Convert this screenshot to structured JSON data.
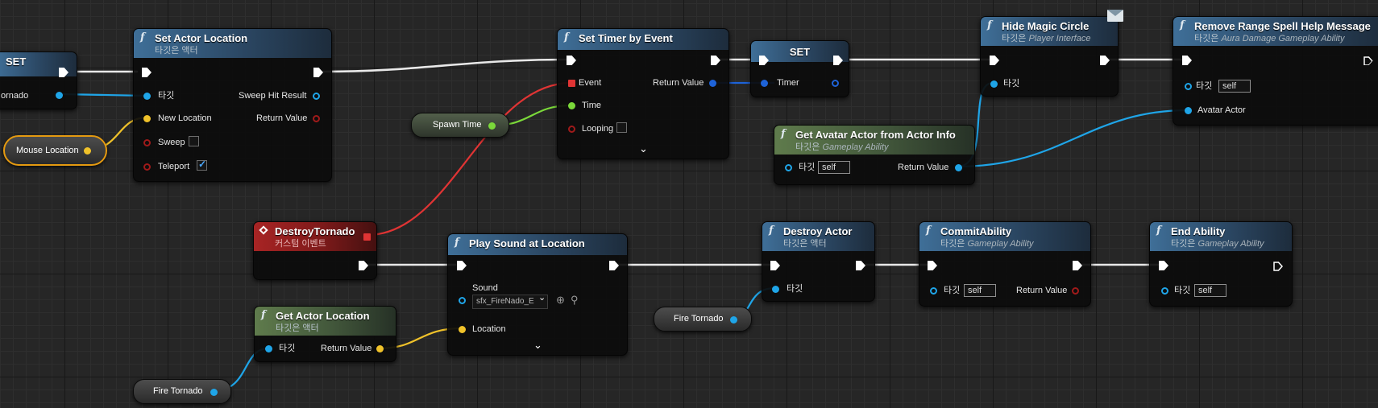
{
  "colors": {
    "exec": "#ffffff",
    "object": "#1fa5e8",
    "vector": "#f0c22a",
    "bool": "#a01a1a",
    "float": "#7bd93a",
    "delegate": "#e03434",
    "timer": "#1e63d8"
  },
  "nodes": {
    "set_left": {
      "title": "SET",
      "pin_label": "ornado"
    },
    "set_actor_location": {
      "title": "Set Actor Location",
      "subtitle": "타깃은 액터",
      "target": "타깃",
      "new_location": "New Location",
      "sweep": "Sweep",
      "teleport": "Teleport",
      "sweep_hit_result": "Sweep Hit Result",
      "return_value": "Return Value",
      "sweep_checked": false,
      "teleport_checked": true
    },
    "set_timer_by_event": {
      "title": "Set Timer by Event",
      "event": "Event",
      "time": "Time",
      "looping": "Looping",
      "return_value": "Return Value",
      "looping_checked": false
    },
    "set_timer": {
      "title": "SET",
      "timer": "Timer"
    },
    "hide_magic_circle": {
      "title": "Hide Magic Circle",
      "subtitle_prefix": "타깃은",
      "subtitle_class": "Player Interface",
      "target": "타깃"
    },
    "remove_range_spell": {
      "title": "Remove Range Spell Help Message",
      "subtitle_prefix": "타깃은",
      "subtitle_class": "Aura Damage Gameplay Ability",
      "target": "타깃",
      "self": "self",
      "avatar_actor": "Avatar Actor"
    },
    "get_avatar_actor": {
      "title": "Get Avatar Actor from Actor Info",
      "subtitle_prefix": "타깃은",
      "subtitle_class": "Gameplay Ability",
      "target": "타깃",
      "self": "self",
      "return_value": "Return Value"
    },
    "destroy_tornado": {
      "title": "DestroyTornado",
      "subtitle": "커스텀 이벤트"
    },
    "play_sound": {
      "title": "Play Sound at Location",
      "sound": "Sound",
      "sound_asset": "sfx_FireNado_E",
      "location": "Location"
    },
    "get_actor_location": {
      "title": "Get Actor Location",
      "subtitle": "타깃은 액터",
      "target": "타깃",
      "return_value": "Return Value"
    },
    "destroy_actor": {
      "title": "Destroy Actor",
      "subtitle": "타깃은 액터",
      "target": "타깃"
    },
    "commit_ability": {
      "title": "CommitAbility",
      "subtitle_prefix": "타깃은",
      "subtitle_class": "Gameplay Ability",
      "target": "타깃",
      "self": "self",
      "return_value": "Return Value"
    },
    "end_ability": {
      "title": "End Ability",
      "subtitle_prefix": "타깃은",
      "subtitle_class": "Gameplay Ability",
      "target": "타깃",
      "self": "self"
    }
  },
  "variables": {
    "mouse_location": "Mouse Location",
    "spawn_time": "Spawn Time",
    "fire_tornado_1": "Fire Tornado",
    "fire_tornado_2": "Fire Tornado"
  }
}
